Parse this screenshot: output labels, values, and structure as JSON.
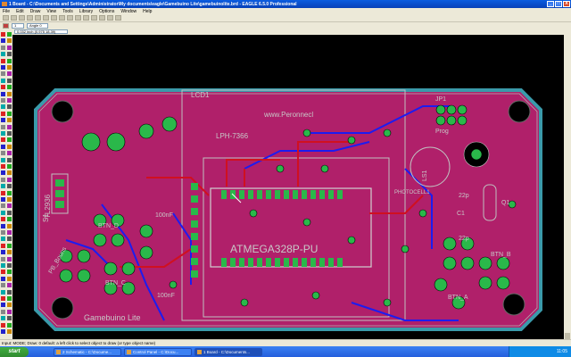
{
  "window": {
    "title": "1 Board - C:\\Documents and Settings\\Administrator\\My documents\\eagle\\Gamebuino Lite\\gamebuinolite.brd - EAGLE 6.5.0 Professional",
    "buttons": [
      "_",
      "□",
      "X"
    ]
  },
  "menu": [
    "File",
    "Edit",
    "Draw",
    "View",
    "Tools",
    "Library",
    "Options",
    "Window",
    "Help"
  ],
  "toolbar": {
    "grid_select": "1",
    "layer_select": "Angle 0"
  },
  "coords": "0.032 inch (0.975 18.39)",
  "board": {
    "labels": [
      "LCD1",
      "LPH-7366",
      "www.Peronnecl",
      "ATMEGA328P-PU",
      "TL2936",
      "BTN_B",
      "BTN_D",
      "BTN_C",
      "BTN_A",
      "100nF",
      "22p",
      "22p",
      "Q1",
      "C1",
      "JP1",
      "Prog",
      "PHOTOCELL1",
      "100nF",
      "PB_Bouns",
      "Gamebuino Lite",
      "S1",
      "LS1"
    ]
  },
  "status": "Input: MODE; Draw: 0 default: a left click to select object to draw (or type object name)",
  "taskbar": {
    "start": "start",
    "tasks": [
      {
        "label": "2 Schematic - C:\\Docume...",
        "active": false
      },
      {
        "label": "Control Panel - C:\\Docu...",
        "active": false
      },
      {
        "label": "1 Board - C:\\Documents...",
        "active": true
      }
    ],
    "clock": "11:05"
  }
}
